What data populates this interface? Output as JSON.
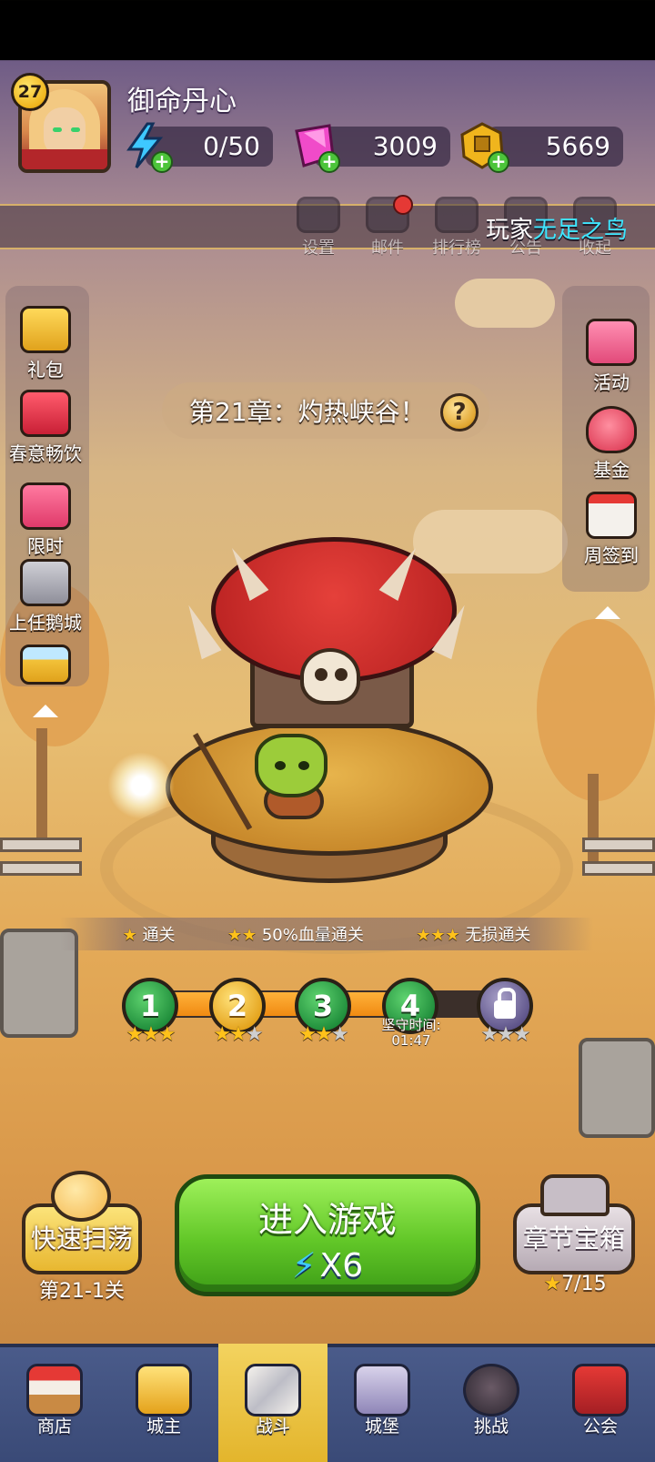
{
  "player": {
    "level": "27",
    "name": "御命丹心"
  },
  "resources": {
    "energy": "0/50",
    "gems": "3009",
    "gold": "5669"
  },
  "top_menu": [
    {
      "label": "设置",
      "icon": "gear-icon"
    },
    {
      "label": "邮件",
      "icon": "mail-icon"
    },
    {
      "label": "排行榜",
      "icon": "leaderboard-icon"
    },
    {
      "label": "公告",
      "icon": "announcement-icon"
    },
    {
      "label": "收起",
      "icon": "collapse-icon"
    }
  ],
  "ticker": {
    "prefix": "玩家",
    "highlight": "无足之鸟"
  },
  "left_sidebar": [
    {
      "label": "礼包",
      "icon": "gift-icon"
    },
    {
      "label": "春意畅饮",
      "icon": "drink-banner-icon"
    },
    {
      "label": "限时",
      "icon": "limited-gift-icon"
    },
    {
      "label": "上任鹅城",
      "icon": "castle-tower-icon"
    },
    {
      "label": "",
      "icon": "beer-mug-icon"
    }
  ],
  "right_sidebar": [
    {
      "label": "活动",
      "icon": "event-icon"
    },
    {
      "label": "基金",
      "icon": "fund-bag-icon"
    },
    {
      "label": "周签到",
      "icon": "calendar-check-icon"
    }
  ],
  "chapter": {
    "title": "第21章：灼热峡谷！",
    "help_symbol": "?"
  },
  "star_requirements": [
    {
      "stars": 1,
      "text": "通关"
    },
    {
      "stars": 2,
      "text": "50%血量通关"
    },
    {
      "stars": 3,
      "text": "无损通关"
    }
  ],
  "stages": [
    {
      "number": "1",
      "stars": 3,
      "state": "cleared",
      "color": "#1e8c3a"
    },
    {
      "number": "2",
      "stars": 2,
      "state": "cleared",
      "color": "#e4a21b"
    },
    {
      "number": "3",
      "stars": 2,
      "state": "cleared",
      "color": "#1e8c3a"
    },
    {
      "number": "4",
      "stars": 0,
      "state": "current",
      "color": "#1e8c3a"
    },
    {
      "number": "",
      "stars": 0,
      "state": "locked",
      "color": "#5c5288"
    }
  ],
  "hold_time": {
    "label": "坚守时间:",
    "value": "01:47"
  },
  "actions": {
    "sweep_label": "快速扫荡",
    "sweep_stage": "第21-1关",
    "enter_label": "进入游戏",
    "enter_cost": "X6",
    "chest_label": "章节宝箱",
    "chest_progress": "7/15"
  },
  "bottom_nav": [
    {
      "label": "商店",
      "icon": "shop-icon",
      "active": false
    },
    {
      "label": "城主",
      "icon": "crown-icon",
      "active": false
    },
    {
      "label": "战斗",
      "icon": "crossed-swords-icon",
      "active": true
    },
    {
      "label": "城堡",
      "icon": "castle-icon",
      "active": false
    },
    {
      "label": "挑战",
      "icon": "demon-helmet-icon",
      "active": false
    },
    {
      "label": "公会",
      "icon": "guild-banner-icon",
      "active": false
    }
  ],
  "colors": {
    "accent_green": "#62c728",
    "gold": "#e8b730",
    "nav_blue": "#3a4a77",
    "star": "#ffc21a",
    "ticker_highlight": "#3ee6ff"
  }
}
